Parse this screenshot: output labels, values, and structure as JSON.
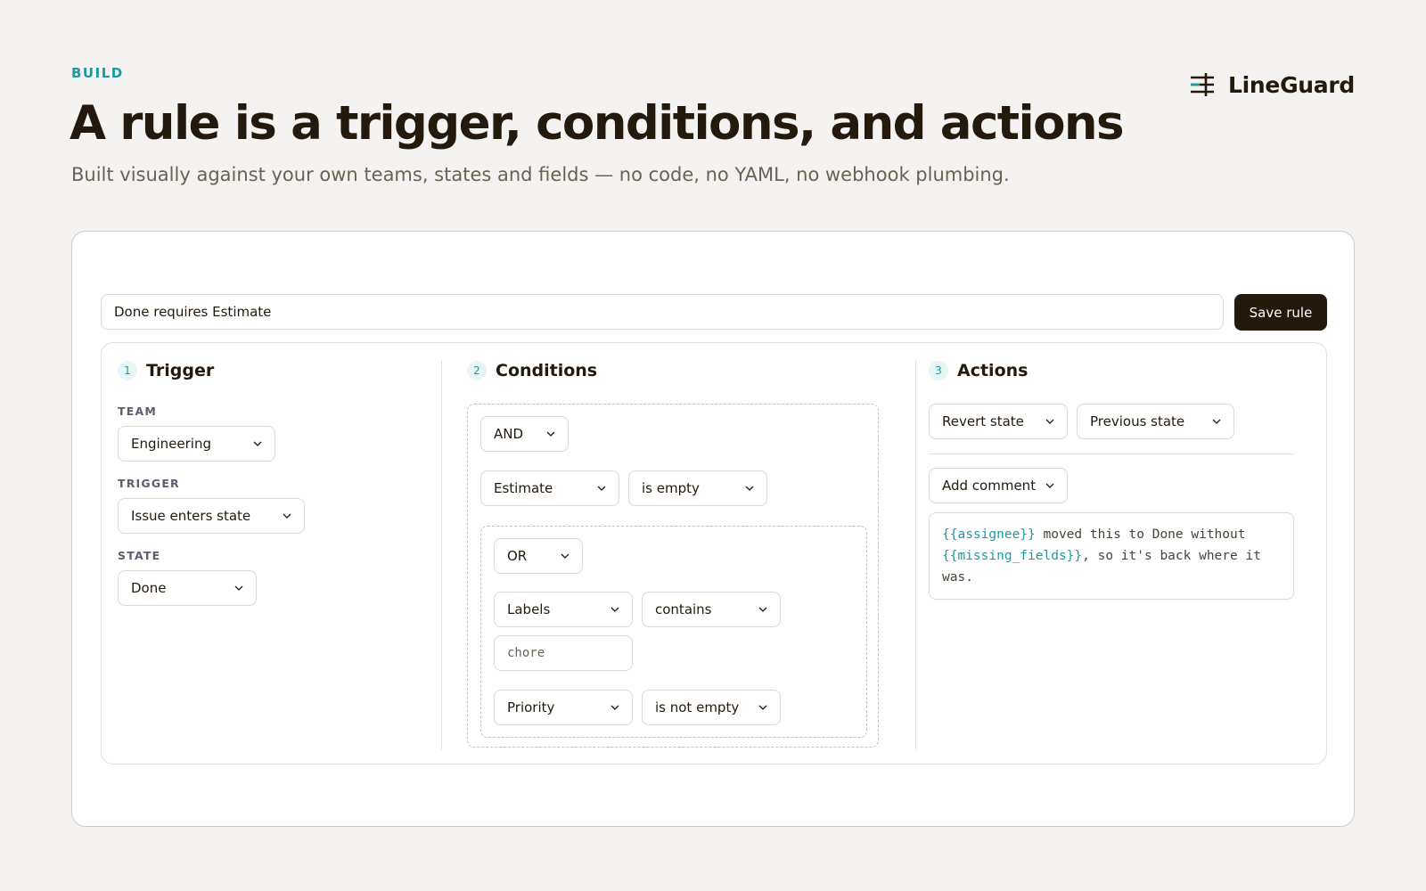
{
  "header": {
    "eyebrow": "BUILD",
    "title": "A rule is a trigger, conditions, and actions",
    "subtitle": "Built visually against your own teams, states and fields — no code, no YAML, no webhook plumbing."
  },
  "brand": {
    "name": "LineGuard",
    "icon": "sliders-icon",
    "accent": "#1c9aa0"
  },
  "rule": {
    "name": "Done requires Estimate",
    "save_label": "Save rule"
  },
  "trigger": {
    "number": "1",
    "title": "Trigger",
    "team_label": "TEAM",
    "team_value": "Engineering",
    "trigger_label": "TRIGGER",
    "trigger_value": "Issue enters state",
    "state_label": "STATE",
    "state_value": "Done"
  },
  "conditions": {
    "number": "2",
    "title": "Conditions",
    "operator": "AND",
    "row1": {
      "field": "Estimate",
      "comparator": "is empty"
    },
    "group": {
      "operator": "OR",
      "row1": {
        "field": "Labels",
        "comparator": "contains",
        "value_placeholder": "chore"
      },
      "row2": {
        "field": "Priority",
        "comparator": "is not empty"
      }
    }
  },
  "actions": {
    "number": "3",
    "title": "Actions",
    "action1": {
      "type": "Revert state",
      "target": "Previous state"
    },
    "action2": {
      "type": "Add comment",
      "comment": {
        "var1": "{{assignee}}",
        "text1": " moved this to Done without ",
        "var2": "{{missing_fields}}",
        "text2": ", so it's back where it was."
      }
    }
  },
  "colors": {
    "background": "#f4f3f1",
    "ink": "#231a0d",
    "accent": "#1c9aa0",
    "muted": "#6b6155"
  }
}
